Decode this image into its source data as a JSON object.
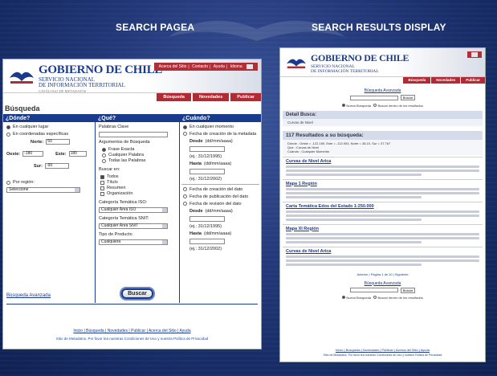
{
  "slide": {
    "left_heading": "SEARCH PAGEA",
    "right_heading": "SEARCH RESULTS DISPLAY"
  },
  "search_page": {
    "brand_title": "GOBIERNO DE CHILE",
    "brand_sub1": "SERVICIO NACIONAL",
    "brand_sub2": "DE INFORMACIÓN TERRITORIAL",
    "brand_sub3": "CATÁLOGO DE METADATOS",
    "top_nav": [
      "Acerca del Sitio",
      "Contacto",
      "Ayuda",
      "Idioma"
    ],
    "tabs": [
      "Búsqueda",
      "Novedades",
      "Publicar"
    ],
    "page_title": "Búsqueda",
    "col_where": {
      "header": "¿Dónde?",
      "opt_any": "En cualquier lugar",
      "opt_coords": "En coordenadas específicas",
      "north_label": "Norte:",
      "north_value": "50",
      "west_label": "Oeste:",
      "west_value": "-180",
      "east_label": "Este:",
      "east_value": "180",
      "south_label": "Sur:",
      "south_value": "-90",
      "opt_region": "Por región:",
      "region_select": "Seleccione"
    },
    "col_what": {
      "header": "¿Qué?",
      "keywords_label": "Palabras Clave",
      "args_label": "Argumentos de Búsqueda",
      "arg1": "Frase Exacta",
      "arg2": "Cualquier Palabra",
      "arg3": "Todas las Palabras",
      "search_in_label": "Buscar en:",
      "in1": "Todos",
      "in2": "Título",
      "in3": "Resumen",
      "in4": "Organización",
      "cat1_label": "Categoría Temática ISO:",
      "cat1_value": "Cualquier Área ISO",
      "cat2_label": "Categoría Temática SNIT:",
      "cat2_value": "Cualquier Área SNIT",
      "type_label": "Tipo de Producto",
      "type_value": "Cualquiera"
    },
    "col_when": {
      "header": "¿Cuándo?",
      "opt_any": "En cualquier momento",
      "opt_creation": "Fecha de creación de la metadata",
      "from_label": "Desde",
      "from_hint": "(dd/mm/aaaa)",
      "eg1": "(ej.: 31/12/1995)",
      "to_label": "Hasta",
      "to_hint": "(dd/mm/aaaa)",
      "eg2": "(ej.: 31/12/2002)",
      "opt_data_creation": "Fecha de creación del dato",
      "opt_publication": "Fecha de publicación del dato",
      "opt_revision": "Fecha de revisión del dato",
      "from2_label": "Desde",
      "from2_hint": "(dd/mm/aaaa)",
      "eg3": "(ej.: 31/12/1995)",
      "to2_label": "Hasta",
      "to2_hint": "(dd/mm/aaaa)",
      "eg4": "(ej.: 31/12/2002)"
    },
    "advanced_link": "Búsqueda Avanzada",
    "search_button": "Buscar",
    "footer_links": "Inicio | Búsqueda | Novedades | Publicar | Acerca del Sitio | Ayuda",
    "footer_note": "Sitio de Metadatos. Por favor lea nuestras Condiciones de Uso y nuestra Política de Privacidad"
  },
  "results_page": {
    "brand_title": "GOBIERNO DE CHILE",
    "brand_sub1": "SERVICIO NACIONAL",
    "brand_sub2": "DE INFORMACIÓN TERRITORIAL",
    "tabs": [
      "Búsqueda",
      "Novedades",
      "Publicar"
    ],
    "advanced_link": "Búsqueda Avanzada",
    "search_button": "Buscar",
    "opt_new": "Nueva Búsqueda",
    "opt_within": "Buscar dentro de los resultados",
    "detail_label": "Detail Busca:",
    "detail_value": "Curvas de Nivel",
    "results_header": "117 Resultados a su búsqueda:",
    "meta_where": "Dónde :  Oeste = -122.169, Este = -113.953, Norte = 38.10, Sur = 37.767",
    "meta_what": "Qué :  Curvas de Nivel",
    "meta_when": "Cuándo :  Cualquier Momento",
    "results": [
      "Curvas de Nivel Arica",
      "Mapa 1 Región",
      "Carta Temática Edos del Estado 1:250.000",
      "Mapa XI Región",
      "Curvas de Nivel Arica"
    ],
    "pager": "Anterior | Página 1 de 10 | Siguiente",
    "footer_links": "Inicio | Búsqueda | Novedades | Publicar | Acerca del Sitio | Ayuda",
    "footer_note": "Sitio de Metadatos. Por favor lea nuestras Condiciones de Uso y nuestra Política de Privacidad"
  }
}
